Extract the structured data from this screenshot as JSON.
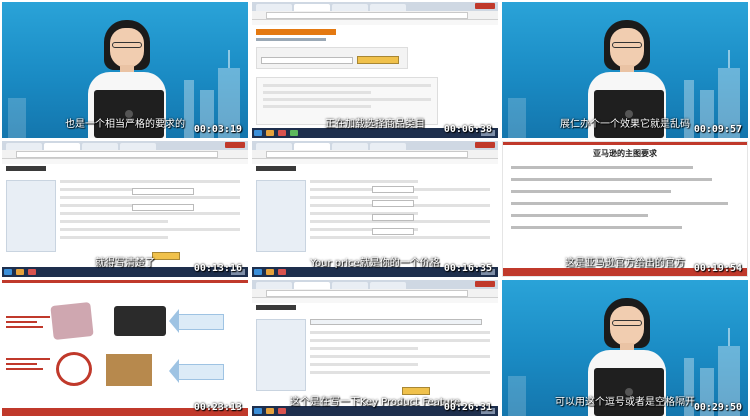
{
  "tiles": [
    {
      "scene": "presenter",
      "subtitle": "也是一个相当严格的要求的",
      "timestamp": "00:03:19"
    },
    {
      "scene": "browser-create",
      "subtitle": "正在加载选择商品类目",
      "timestamp": "00:06:38"
    },
    {
      "scene": "presenter",
      "subtitle": "展仁办个一个效果它就是乱码",
      "timestamp": "00:09:57"
    },
    {
      "scene": "browser-form",
      "subtitle": "就得写清楚了",
      "timestamp": "00:13:16"
    },
    {
      "scene": "browser-form",
      "subtitle": "Your price就是你的一个价格",
      "timestamp": "00:16:35"
    },
    {
      "scene": "slide",
      "slide_title": "亚马逊的主图要求",
      "subtitle": "这是亚马逊官方给出的官方",
      "timestamp": "00:19:54"
    },
    {
      "scene": "diagram",
      "subtitle": "",
      "timestamp": "00:23:13"
    },
    {
      "scene": "browser-form",
      "subtitle": "这个是在写一下Key Product Feature",
      "timestamp": "00:26:31"
    },
    {
      "scene": "presenter",
      "subtitle": "可以用这个逗号或者是空格隔开",
      "timestamp": "00:29:50"
    }
  ],
  "colors": {
    "presenter_bg": "#1a8bc4",
    "slide_accent": "#c0392b",
    "amazon_orange": "#e47911",
    "taskbar": "#1e2f4d"
  }
}
